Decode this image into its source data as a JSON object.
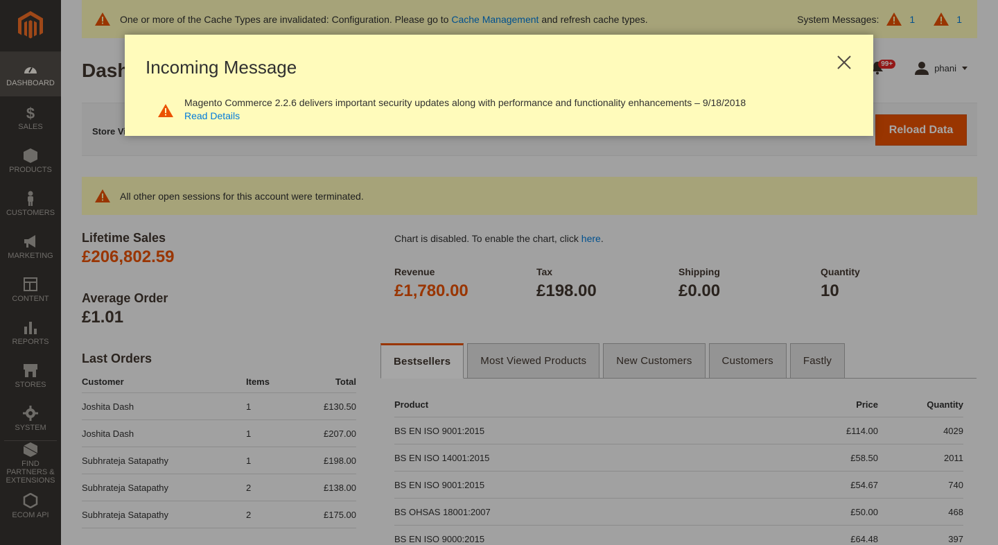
{
  "sidebar": {
    "items": [
      {
        "label": "DASHBOARD",
        "icon": "dashboard-icon",
        "active": true
      },
      {
        "label": "SALES",
        "icon": "dollar-icon"
      },
      {
        "label": "PRODUCTS",
        "icon": "box-icon"
      },
      {
        "label": "CUSTOMERS",
        "icon": "person-icon"
      },
      {
        "label": "MARKETING",
        "icon": "megaphone-icon"
      },
      {
        "label": "CONTENT",
        "icon": "layout-icon"
      },
      {
        "label": "REPORTS",
        "icon": "bar-chart-icon"
      },
      {
        "label": "STORES",
        "icon": "store-icon"
      },
      {
        "label": "SYSTEM",
        "icon": "gear-icon"
      },
      {
        "label": "FIND PARTNERS & EXTENSIONS",
        "icon": "cubes-icon"
      },
      {
        "label": "ECOM API",
        "icon": "hexagon-icon"
      }
    ]
  },
  "system_message": {
    "text_before": "One or more of the Cache Types are invalidated: Configuration. Please go to",
    "link": "Cache Management",
    "text_after": "and refresh cache types.",
    "label": "System Messages:",
    "count_1": "1",
    "count_2": "1"
  },
  "header": {
    "title": "Dashboard",
    "notifications_badge": "99+",
    "username": "phani"
  },
  "store_bar": {
    "label": "Store View:",
    "reload_label": "Reload Data"
  },
  "session_message": "All other open sessions for this account were terminated.",
  "stats": {
    "lifetime_label": "Lifetime Sales",
    "lifetime_value": "£206,802.59",
    "average_label": "Average Order",
    "average_value": "£1.01",
    "last_orders_label": "Last Orders"
  },
  "last_orders": {
    "headers": {
      "customer": "Customer",
      "items": "Items",
      "total": "Total"
    },
    "rows": [
      {
        "customer": "Joshita Dash",
        "items": "1",
        "total": "£130.50"
      },
      {
        "customer": "Joshita Dash",
        "items": "1",
        "total": "£207.00"
      },
      {
        "customer": "Subhrateja Satapathy",
        "items": "1",
        "total": "£198.00"
      },
      {
        "customer": "Subhrateja Satapathy",
        "items": "2",
        "total": "£138.00"
      },
      {
        "customer": "Subhrateja Satapathy",
        "items": "2",
        "total": "£175.00"
      }
    ]
  },
  "chart_note": {
    "text": "Chart is disabled. To enable the chart, click",
    "link": "here",
    "after": "."
  },
  "totals": [
    {
      "label": "Revenue",
      "value": "£1,780.00",
      "color": "#eb5202"
    },
    {
      "label": "Tax",
      "value": "£198.00",
      "color": "#41362f"
    },
    {
      "label": "Shipping",
      "value": "£0.00",
      "color": "#41362f"
    },
    {
      "label": "Quantity",
      "value": "10",
      "color": "#41362f"
    }
  ],
  "tabs": [
    "Bestsellers",
    "Most Viewed Products",
    "New Customers",
    "Customers",
    "Fastly"
  ],
  "bestsellers": {
    "headers": {
      "product": "Product",
      "price": "Price",
      "quantity": "Quantity"
    },
    "rows": [
      {
        "product": "BS EN ISO 9001:2015",
        "price": "£114.00",
        "quantity": "4029"
      },
      {
        "product": "BS EN ISO 14001:2015",
        "price": "£58.50",
        "quantity": "2011"
      },
      {
        "product": "BS EN ISO 9001:2015",
        "price": "£54.67",
        "quantity": "740"
      },
      {
        "product": "BS OHSAS 18001:2007",
        "price": "£50.00",
        "quantity": "468"
      },
      {
        "product": "BS EN ISO 9000:2015",
        "price": "£64.48",
        "quantity": "397"
      }
    ]
  },
  "modal": {
    "title": "Incoming Message",
    "message": "Magento Commerce 2.2.6 delivers important security updates along with performance and functionality enhancements – 9/18/2018",
    "link": "Read Details"
  },
  "colors": {
    "accent": "#eb5202",
    "sidebar": "#373330",
    "message_bg": "#fffbbb",
    "link": "#007bdb"
  }
}
